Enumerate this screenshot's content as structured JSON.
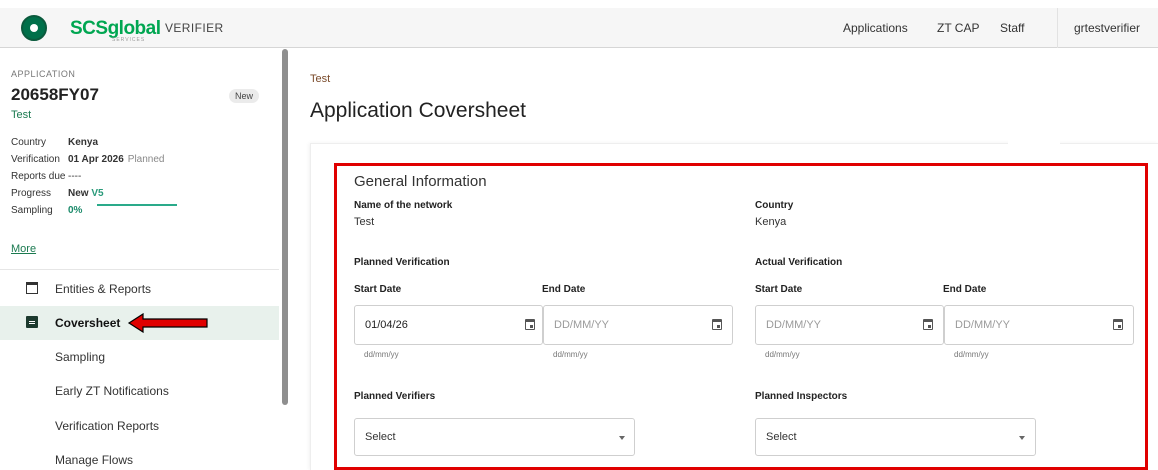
{
  "header": {
    "brand": "SCSglobal",
    "brand_sub": "SERVICES",
    "app_tag": "VERIFIER",
    "nav": [
      "Applications",
      "ZT CAP",
      "Staff",
      "grtestverifier"
    ]
  },
  "sidebar": {
    "application_label": "APPLICATION",
    "application_id": "20658FY07",
    "status_badge": "New",
    "application_name": "Test",
    "meta": {
      "country_label": "Country",
      "country_value": "Kenya",
      "verification_label": "Verification",
      "verification_value": "01 Apr 2026",
      "verification_status": "Planned",
      "reports_label": "Reports due",
      "reports_value": "----",
      "progress_label": "Progress",
      "progress_value": "New",
      "progress_version": "V5",
      "sampling_label": "Sampling",
      "sampling_value": "0%"
    },
    "more_link": "More",
    "items": [
      {
        "label": "Entities & Reports"
      },
      {
        "label": "Coversheet"
      },
      {
        "label": "Sampling"
      },
      {
        "label": "Early ZT Notifications"
      },
      {
        "label": "Verification Reports"
      },
      {
        "label": "Manage Flows"
      }
    ]
  },
  "main": {
    "breadcrumb": "Test",
    "title": "Application Coversheet",
    "section_title": "General Information",
    "network_label": "Name of the network",
    "network_value": "Test",
    "country_label": "Country",
    "country_value": "Kenya",
    "planned_verification_label": "Planned Verification",
    "actual_verification_label": "Actual Verification",
    "start_date_label": "Start Date",
    "end_date_label": "End Date",
    "planned_start_value": "01/04/26",
    "date_placeholder": "DD/MM/YY",
    "date_hint": "dd/mm/yy",
    "planned_verifiers_label": "Planned Verifiers",
    "planned_inspectors_label": "Planned Inspectors",
    "select_placeholder": "Select"
  },
  "colors": {
    "brand_green": "#00a651",
    "highlight_red": "#e00000",
    "active_item_bg": "#e8f1ec"
  }
}
